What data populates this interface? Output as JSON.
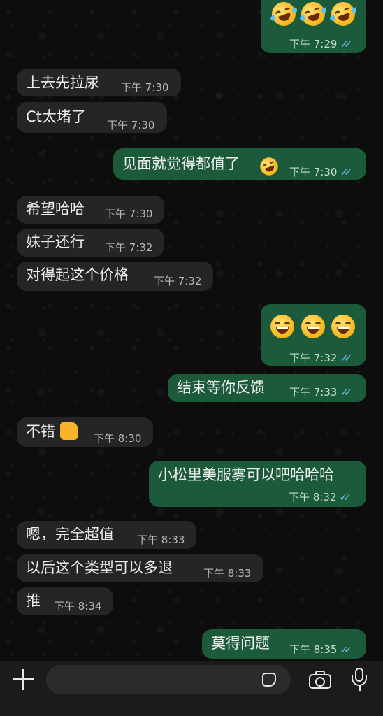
{
  "messages": [
    {
      "dir": "out",
      "type": "emoji",
      "emoji_name": "rolling-on-floor-laughing",
      "count": 3,
      "time": "下午 7:29",
      "status": "read"
    },
    {
      "dir": "in",
      "text": "上去先拉尿",
      "time": "下午 7:30"
    },
    {
      "dir": "in",
      "text": "Ct太堵了",
      "time": "下午 7:30"
    },
    {
      "dir": "out",
      "text": "见面就觉得都值了",
      "emoji_name": "rolling-on-floor-laughing",
      "time": "下午 7:30",
      "status": "read"
    },
    {
      "dir": "in",
      "text": "希望哈哈",
      "time": "下午 7:30"
    },
    {
      "dir": "in",
      "text": "妹子还行",
      "time": "下午 7:32"
    },
    {
      "dir": "in",
      "text": "对得起这个价格",
      "time": "下午 7:32"
    },
    {
      "dir": "out",
      "type": "emoji",
      "emoji_name": "grinning-face-with-smiling-eyes",
      "count": 3,
      "time": "下午 7:32",
      "status": "read"
    },
    {
      "dir": "out",
      "text": "结束等你反馈",
      "time": "下午 7:33",
      "status": "read"
    },
    {
      "dir": "in",
      "text": "不错",
      "emoji_name": "thumbs-up",
      "time": "下午 8:30"
    },
    {
      "dir": "out",
      "text": "小松里美服雾可以吧哈哈哈",
      "time": "下午 8:32",
      "status": "read"
    },
    {
      "dir": "in",
      "text": "嗯，完全超值",
      "time": "下午 8:33"
    },
    {
      "dir": "in",
      "text": "以后这个类型可以多退",
      "time": "下午 8:33"
    },
    {
      "dir": "in",
      "text": "推",
      "time": "下午 8:34"
    },
    {
      "dir": "out",
      "text": "莫得问题",
      "time": "下午 8:35",
      "status": "read"
    }
  ],
  "ticks": "✓✓",
  "input_bar": {
    "placeholder": "",
    "icons": [
      "plus-icon",
      "sticker-icon",
      "camera-icon",
      "microphone-icon"
    ]
  },
  "colors": {
    "incoming_bubble": "#252525",
    "outgoing_bubble": "#1c5a3c",
    "read_ticks": "#6fc6f5"
  }
}
